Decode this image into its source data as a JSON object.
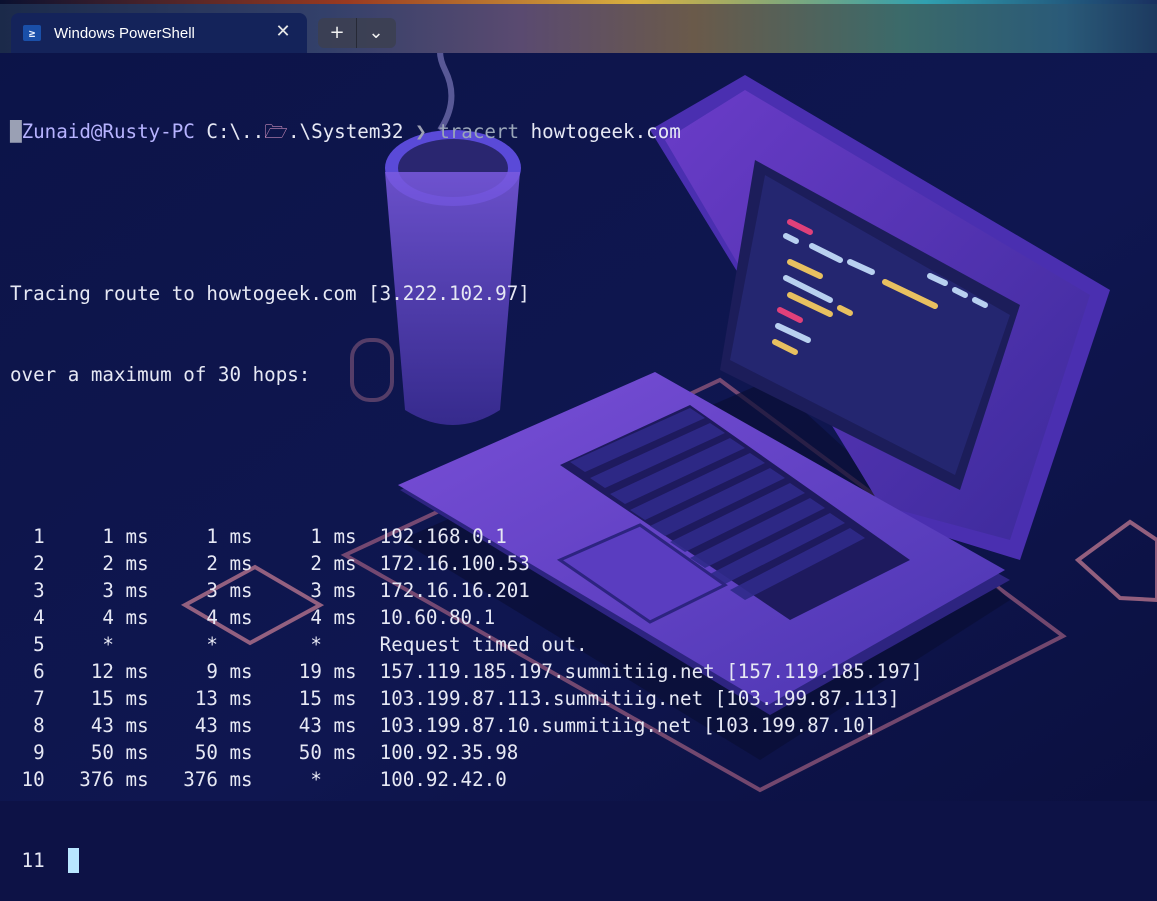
{
  "tab": {
    "title": "Windows PowerShell",
    "icon": "powershell-icon",
    "icon_glyph": "≥",
    "close_glyph": "✕"
  },
  "toolbar": {
    "new_tab_glyph": "+",
    "dropdown_glyph": "⌄"
  },
  "prompt": {
    "user_host": "Zunaid@Rusty-PC",
    "path_prefix": "C:\\..",
    "folder_glyph": "🗁",
    "path_suffix": ".\\System32",
    "separator": "❯",
    "command": "tracert",
    "argument": "howtogeek.com"
  },
  "output": {
    "header_line_1": "Tracing route to howtogeek.com [3.222.102.97]",
    "header_line_2": "over a maximum of 30 hops:",
    "hops": [
      {
        "num": "1",
        "rtt1": "1 ms",
        "rtt2": "1 ms",
        "rtt3": "1 ms",
        "host": "192.168.0.1"
      },
      {
        "num": "2",
        "rtt1": "2 ms",
        "rtt2": "2 ms",
        "rtt3": "2 ms",
        "host": "172.16.100.53"
      },
      {
        "num": "3",
        "rtt1": "3 ms",
        "rtt2": "3 ms",
        "rtt3": "3 ms",
        "host": "172.16.16.201"
      },
      {
        "num": "4",
        "rtt1": "4 ms",
        "rtt2": "4 ms",
        "rtt3": "4 ms",
        "host": "10.60.80.1"
      },
      {
        "num": "5",
        "rtt1": "*",
        "rtt2": "*",
        "rtt3": "*",
        "host": "Request timed out."
      },
      {
        "num": "6",
        "rtt1": "12 ms",
        "rtt2": "9 ms",
        "rtt3": "19 ms",
        "host": "157.119.185.197.summitiig.net [157.119.185.197]"
      },
      {
        "num": "7",
        "rtt1": "15 ms",
        "rtt2": "13 ms",
        "rtt3": "15 ms",
        "host": "103.199.87.113.summitiig.net [103.199.87.113]"
      },
      {
        "num": "8",
        "rtt1": "43 ms",
        "rtt2": "43 ms",
        "rtt3": "43 ms",
        "host": "103.199.87.10.summitiig.net [103.199.87.10]"
      },
      {
        "num": "9",
        "rtt1": "50 ms",
        "rtt2": "50 ms",
        "rtt3": "50 ms",
        "host": "100.92.35.98"
      },
      {
        "num": "10",
        "rtt1": "376 ms",
        "rtt2": "376 ms",
        "rtt3": "*",
        "host": "100.92.42.0"
      }
    ],
    "current_hop": "11"
  },
  "colors": {
    "background": "#0d1246",
    "text": "#e6e8f4",
    "user_host": "#b7b3ff",
    "cursor": "#b8e6ff"
  }
}
